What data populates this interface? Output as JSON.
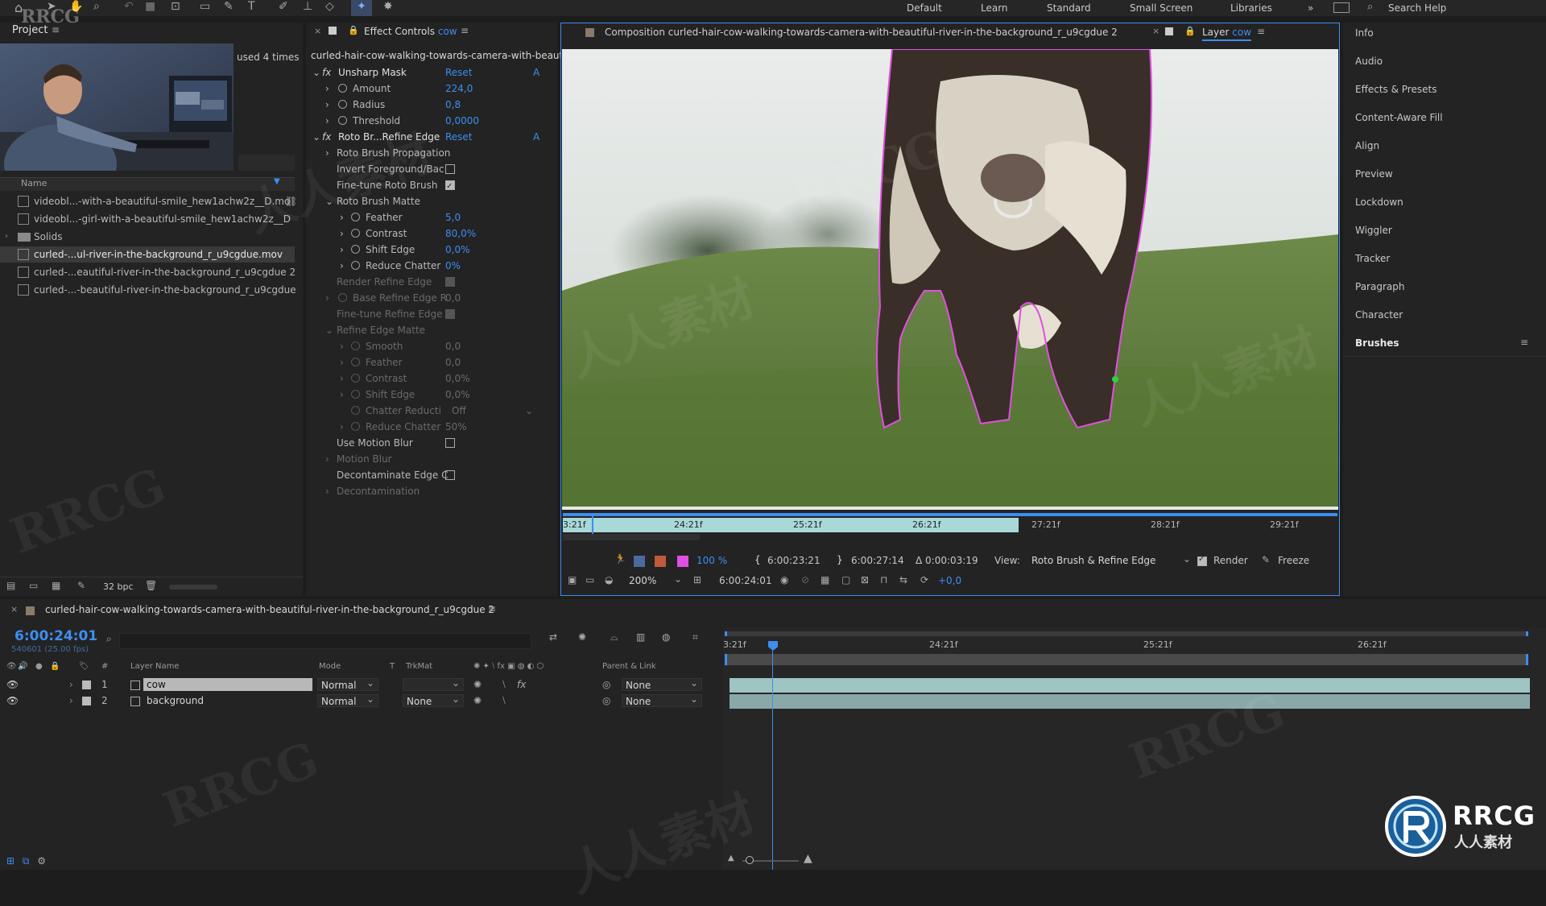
{
  "menu": {
    "workspaces": [
      "Default",
      "Learn",
      "Standard",
      "Small Screen",
      "Libraries"
    ],
    "more": "»",
    "search_help": "Search Help",
    "logo_text": "RRCG"
  },
  "project": {
    "title": "Project",
    "used_times": "used 4 times",
    "name_header": "Name",
    "items": [
      {
        "name": "videobl...-with-a-beautiful-smile_hew1achw2z__D.mo"
      },
      {
        "name": "videobl...-girl-with-a-beautiful-smile_hew1achw2z__D"
      },
      {
        "name": "Solids"
      },
      {
        "name": "curled-...ul-river-in-the-background_r_u9cgdue.mov"
      },
      {
        "name": "curled-...eautiful-river-in-the-background_r_u9cgdue 2"
      },
      {
        "name": "curled-...-beautiful-river-in-the-background_r_u9cgdue"
      }
    ],
    "bpc": "32 bpc"
  },
  "effects": {
    "tab_label": "Effect Controls",
    "tab_layer": "cow",
    "comp_name": "curled-hair-cow-walking-towards-camera-with-beauti",
    "fx_icon": "fx",
    "reset": "Reset",
    "a_label": "A",
    "unsharp": {
      "title": "Unsharp Mask",
      "amount_label": "Amount",
      "amount": "224,0",
      "radius_label": "Radius",
      "radius": "0,8",
      "threshold_label": "Threshold",
      "threshold": "0,0000"
    },
    "roto": {
      "title": "Roto Br...Refine Edge",
      "propagation": "Roto Brush Propagation",
      "invert": "Invert Foreground/Bac",
      "finetune": "Fine-tune Roto Brush",
      "matte": "Roto Brush Matte",
      "feather_label": "Feather",
      "feather": "5,0",
      "contrast_label": "Contrast",
      "contrast": "80,0%",
      "shift_label": "Shift Edge",
      "shift": "0,0%",
      "chatter_label": "Reduce Chatter",
      "chatter": "0%",
      "render_refine": "Render Refine Edge",
      "base_refine": "Base Refine Edge R",
      "base_refine_val": "0,0",
      "finetune_refine": "Fine-tune Refine Edge",
      "refine_matte": "Refine Edge Matte",
      "smooth_label": "Smooth",
      "smooth": "0,0",
      "r_feather_label": "Feather",
      "r_feather": "0,0",
      "r_contrast_label": "Contrast",
      "r_contrast": "0,0%",
      "r_shift_label": "Shift Edge",
      "r_shift": "0,0%",
      "chatter_red_label": "Chatter Reducti",
      "chatter_red": "Off",
      "r_reduce_label": "Reduce Chatter",
      "r_reduce": "50%",
      "motion_blur_use": "Use Motion Blur",
      "motion_blur": "Motion Blur",
      "decontam_edge": "Decontaminate Edge C",
      "decontam": "Decontamination"
    }
  },
  "viewer": {
    "comp_tab": "Composition curled-hair-cow-walking-towards-camera-with-beautiful-river-in-the-background_r_u9cgdue 2",
    "layer_tab_label": "Layer",
    "layer_tab_name": "cow",
    "ruler_ticks": [
      "3:21f",
      "24:21f",
      "25:21f",
      "26:21f",
      "27:21f",
      "28:21f",
      "29:21f"
    ],
    "zoom_pct": "100 %",
    "time_in": "6:00:23:21",
    "time_out": "6:00:27:14",
    "duration": "Δ 0:00:03:19",
    "view_label": "View:",
    "view_value": "Roto Brush & Refine Edge",
    "render_label": "Render",
    "freeze_label": "Freeze",
    "magnification": "200%",
    "current_time": "6:00:24:01",
    "exposure": "+0,0"
  },
  "right_panel": {
    "items": [
      "Info",
      "Audio",
      "Effects & Presets",
      "Content-Aware Fill",
      "Align",
      "Preview",
      "Lockdown",
      "Wiggler",
      "Tracker",
      "Paragraph",
      "Character",
      "Brushes"
    ]
  },
  "timeline": {
    "comp_name": "curled-hair-cow-walking-towards-camera-with-beautiful-river-in-the-background_r_u9cgdue 2",
    "timecode": "6:00:24:01",
    "frames": "540601 (25.00 fps)",
    "col_hash": "#",
    "col_layer": "Layer Name",
    "col_mode": "Mode",
    "col_t": "T",
    "col_trkmat": "TrkMat",
    "col_parent": "Parent & Link",
    "ruler_ticks": [
      "3:21f",
      "24:21f",
      "25:21f",
      "26:21f"
    ],
    "layers": [
      {
        "num": "1",
        "name": "cow",
        "mode": "Normal",
        "trkmat": "",
        "parent": "None"
      },
      {
        "num": "2",
        "name": "background",
        "mode": "Normal",
        "trkmat": "None",
        "parent": "None"
      }
    ]
  },
  "watermark": {
    "brand": "RRCG",
    "subtitle": "人人素材"
  },
  "colors": {
    "accent": "#3d8ef0",
    "roto_outline": "#e050e0",
    "panel": "#232323",
    "bg": "#1d1d1d"
  }
}
